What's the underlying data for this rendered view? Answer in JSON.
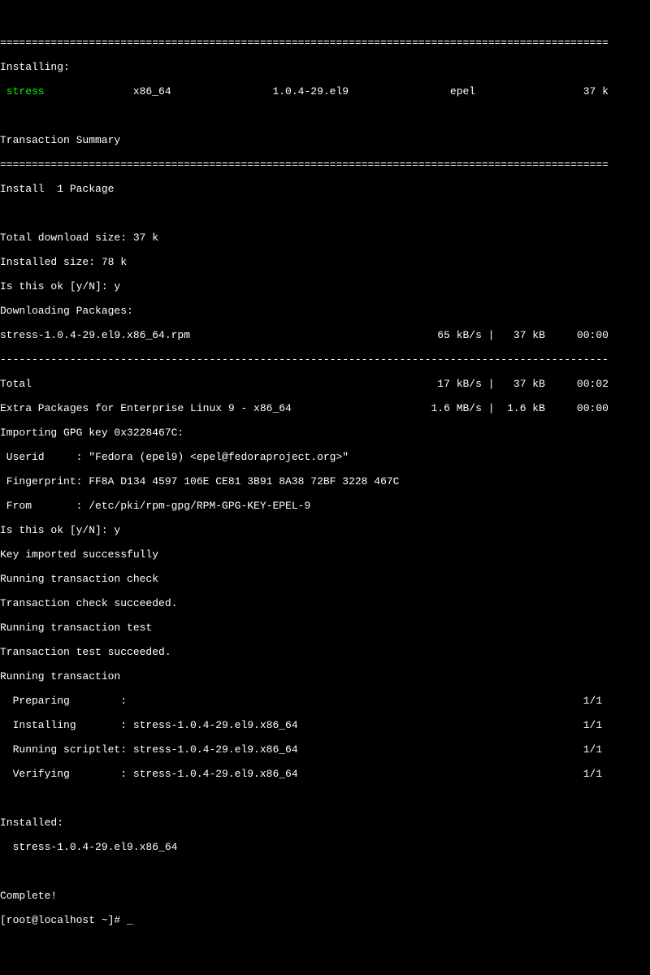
{
  "divider": "================================================================================================",
  "dashline": "------------------------------------------------------------------------------------------------",
  "installing_header": "Installing:",
  "package": {
    "name": " stress",
    "arch": "x86_64",
    "version": "1.0.4-29.el9",
    "repo": "epel",
    "size": "37 k"
  },
  "transaction_summary": "Transaction Summary",
  "install_count": "Install  1 Package",
  "download_size": "Total download size: 37 k",
  "installed_size": "Installed size: 78 k",
  "confirm1": "Is this ok [y/N]: y",
  "downloading": "Downloading Packages:",
  "download_line": {
    "file": "stress-1.0.4-29.el9.x86_64.rpm",
    "speed": "65 kB/s",
    "size": "37 kB",
    "time": "00:00"
  },
  "total_line": {
    "label": "Total",
    "speed": "17 kB/s",
    "size": "37 kB",
    "time": "00:02"
  },
  "epel_line": {
    "label": "Extra Packages for Enterprise Linux 9 - x86_64",
    "speed": "1.6 MB/s",
    "size": "1.6 kB",
    "time": "00:00"
  },
  "importing": "Importing GPG key 0x3228467C:",
  "userid": " Userid     : \"Fedora (epel9) <epel@fedoraproject.org>\"",
  "fingerprint": " Fingerprint: FF8A D134 4597 106E CE81 3B91 8A38 72BF 3228 467C",
  "from": " From       : /etc/pki/rpm-gpg/RPM-GPG-KEY-EPEL-9",
  "confirm2": "Is this ok [y/N]: y",
  "key_imported": "Key imported successfully",
  "run_check": "Running transaction check",
  "check_ok": "Transaction check succeeded.",
  "run_test": "Running transaction test",
  "test_ok": "Transaction test succeeded.",
  "run_trans": "Running transaction",
  "step_prepare": "  Preparing        :                                                                        1/1",
  "step_install": "  Installing       : stress-1.0.4-29.el9.x86_64                                             1/1",
  "step_script": "  Running scriptlet: stress-1.0.4-29.el9.x86_64                                             1/1",
  "step_verify": "  Verifying        : stress-1.0.4-29.el9.x86_64                                             1/1",
  "installed_header": "Installed:",
  "installed_pkg": "  stress-1.0.4-29.el9.x86_64",
  "complete": "Complete!",
  "prompt": "[root@localhost ~]# ",
  "cursor": "_"
}
